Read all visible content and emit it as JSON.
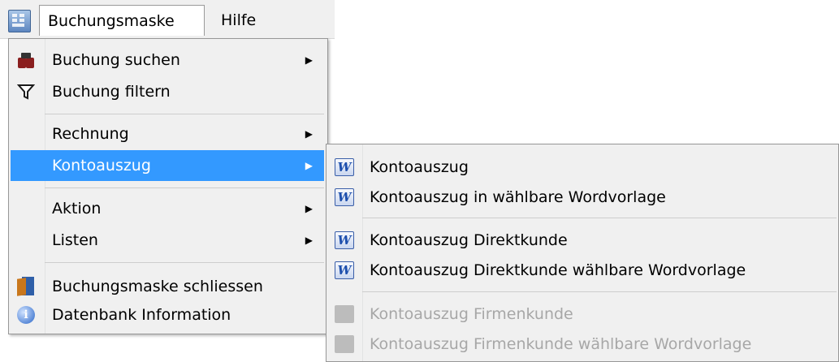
{
  "menubar": {
    "menus": [
      "Buchungsmaske",
      "Hilfe"
    ]
  },
  "main_menu": {
    "items": [
      {
        "label": "Buchung suchen",
        "icon": "binoculars-icon",
        "submenu": true
      },
      {
        "label": "Buchung filtern",
        "icon": "filter-icon",
        "submenu": false
      },
      {
        "label": "Rechnung",
        "icon": "",
        "submenu": true
      },
      {
        "label": "Kontoauszug",
        "icon": "",
        "submenu": true,
        "highlighted": true
      },
      {
        "label": "Aktion",
        "icon": "",
        "submenu": true
      },
      {
        "label": "Listen",
        "icon": "",
        "submenu": true
      },
      {
        "label": "Buchungsmaske schliessen",
        "icon": "door-exit-icon",
        "submenu": false
      },
      {
        "label": "Datenbank Information",
        "icon": "info-icon",
        "submenu": false
      }
    ]
  },
  "sub_menu": {
    "items": [
      {
        "label": "Kontoauszug",
        "icon": "word-icon",
        "enabled": true
      },
      {
        "label": "Kontoauszug in wählbare Wordvorlage",
        "icon": "word-icon",
        "enabled": true
      },
      {
        "label": "Kontoauszug Direktkunde",
        "icon": "word-icon",
        "enabled": true
      },
      {
        "label": "Kontoauszug Direktkunde wählbare Wordvorlage",
        "icon": "word-icon",
        "enabled": true
      },
      {
        "label": "Kontoauszug Firmenkunde",
        "icon": "word-icon",
        "enabled": false
      },
      {
        "label": "Kontoauszug Firmenkunde wählbare Wordvorlage",
        "icon": "word-icon",
        "enabled": false
      }
    ]
  },
  "colors": {
    "highlight": "#3399ff",
    "menu_bg": "#f0f0f0",
    "disabled_text": "#a7a7a7"
  }
}
